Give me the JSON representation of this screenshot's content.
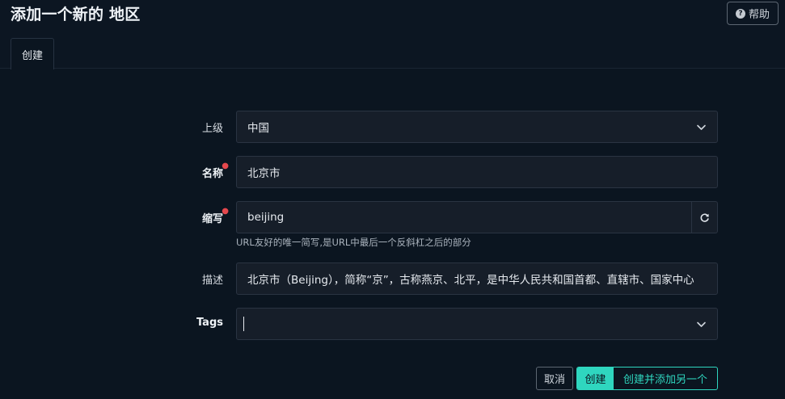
{
  "header": {
    "title": "添加一个新的 地区",
    "help_label": "帮助",
    "help_icon": "question-circle-icon"
  },
  "tabs": [
    {
      "label": "创建",
      "active": true
    }
  ],
  "form": {
    "parent": {
      "label": "上级",
      "value": "中国"
    },
    "name": {
      "label": "名称",
      "value": "北京市",
      "required": true
    },
    "slug": {
      "label": "缩写",
      "value": "beijing",
      "required": true,
      "help": "URL友好的唯一简写,是URL中最后一个反斜杠之后的部分"
    },
    "description": {
      "label": "描述",
      "value": "北京市（Beijing），简称“京”，古称燕京、北平，是中华人民共和国首都、直辖市、国家中心"
    },
    "tags": {
      "label": "Tags",
      "value": ""
    }
  },
  "actions": {
    "cancel_label": "取消",
    "create_label": "创建",
    "create_add_another_label": "创建并添加另一个"
  },
  "colors": {
    "accent": "#2fd6bf",
    "background": "#0b1520",
    "field_background": "#161e29",
    "required": "#e5484d"
  }
}
